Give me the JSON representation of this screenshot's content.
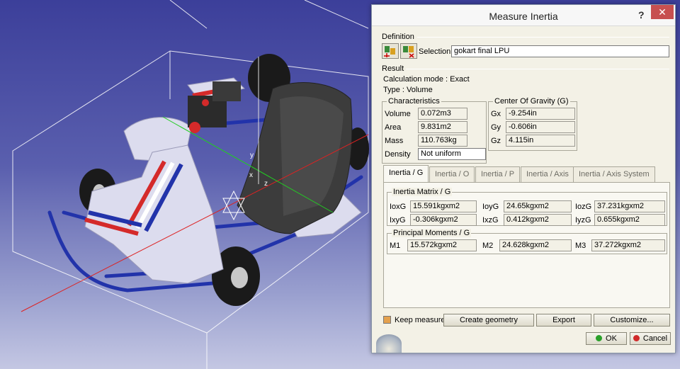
{
  "dialog": {
    "title": "Measure Inertia",
    "help": "?",
    "close": "✕",
    "definition_label": "Definition",
    "selection_label": "Selection :",
    "selection_value": "gokart final LPU",
    "result_label": "Result",
    "calc_mode": "Calculation mode : Exact",
    "type": "Type : Volume"
  },
  "characteristics": {
    "title": "Characteristics",
    "rows": [
      {
        "label": "Volume",
        "value": "0.072m3"
      },
      {
        "label": "Area",
        "value": "9.831m2"
      },
      {
        "label": "Mass",
        "value": "110.763kg"
      },
      {
        "label": "Density",
        "value": "Not uniform"
      }
    ]
  },
  "cog": {
    "title": "Center Of Gravity (G)",
    "rows": [
      {
        "label": "Gx",
        "value": "-9.254in"
      },
      {
        "label": "Gy",
        "value": "-0.606in"
      },
      {
        "label": "Gz",
        "value": "4.115in"
      }
    ]
  },
  "tabs": [
    "Inertia / G",
    "Inertia / O",
    "Inertia / P",
    "Inertia / Axis",
    "Inertia / Axis System"
  ],
  "inertia_matrix": {
    "title": "Inertia Matrix / G",
    "row1": [
      {
        "label": "IoxG",
        "value": "15.591kgxm2"
      },
      {
        "label": "IoyG",
        "value": "24.65kgxm2"
      },
      {
        "label": "IozG",
        "value": "37.231kgxm2"
      }
    ],
    "row2": [
      {
        "label": "IxyG",
        "value": "-0.306kgxm2"
      },
      {
        "label": "IxzG",
        "value": "0.412kgxm2"
      },
      {
        "label": "IyzG",
        "value": "0.655kgxm2"
      }
    ]
  },
  "principal": {
    "title": "Principal Moments / G",
    "row": [
      {
        "label": "M1",
        "value": "15.572kgxm2"
      },
      {
        "label": "M2",
        "value": "24.628kgxm2"
      },
      {
        "label": "M3",
        "value": "37.272kgxm2"
      }
    ]
  },
  "footer": {
    "keep_measure": "Keep measure",
    "create_geometry": "Create geometry",
    "export": "Export",
    "customize": "Customize...",
    "ok": "OK",
    "cancel": "Cancel"
  },
  "viewport": {
    "axis_labels": {
      "x": "x",
      "y": "y",
      "z": "z"
    }
  }
}
